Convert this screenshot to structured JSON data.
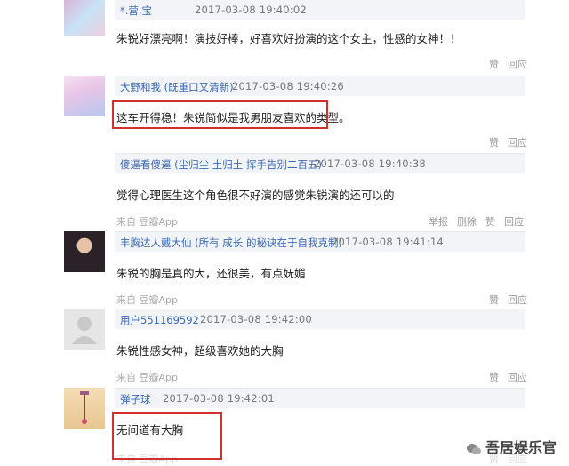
{
  "comments": [
    {
      "user": "*.营.宝",
      "time": "2017-03-08 19:40:02",
      "text": "朱锐好漂亮啊！演技好棒，好喜欢好扮演的这个女主，性感的女神！！",
      "actions": [
        "赞",
        "回应"
      ]
    },
    {
      "user": "大野和我 (既重口又清新)",
      "time": "2017-03-08 19:40:26",
      "text": "这车开得稳！朱锐简似是我男朋友喜欢的类型。",
      "actions": [
        "赞",
        "回应"
      ]
    },
    {
      "user": "傻逼看傻逼 (尘归尘 土归土 挥手告别二百五)",
      "time": "2017-03-08 19:40:38",
      "text": "觉得心理医生这个角色很不好演的感觉朱锐演的还可以的",
      "from": "来自 豆瓣App",
      "actions": [
        "举报",
        "删除",
        "赞",
        "回应"
      ]
    },
    {
      "user": "丰胸达人戴大仙 (所有 成长 的秘诀在于自我克制)",
      "time": "2017-03-08 19:41:14",
      "text": "朱锐的胸是真的大，还很美，有点妩媚",
      "from": "来自 豆瓣App",
      "actions": [
        "赞",
        "回应"
      ]
    },
    {
      "user": "用户551169592",
      "time": "2017-03-08 19:42:00",
      "text": "朱锐性感女神，超级喜欢她的大胸",
      "from": "来自 豆瓣App",
      "actions": [
        "赞",
        "回应"
      ]
    },
    {
      "user": "弹子球",
      "time": "2017-03-08 19:42:01",
      "text": "无间道有大胸",
      "from": "来自 豆瓣App",
      "actions": [
        "赞",
        "回应"
      ]
    }
  ],
  "watermark": "吾居娱乐官"
}
